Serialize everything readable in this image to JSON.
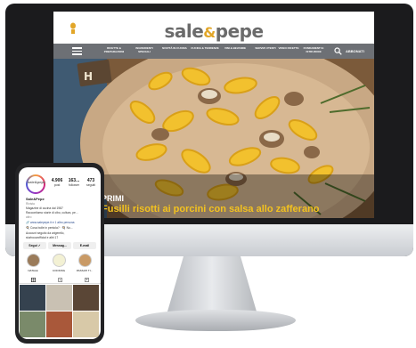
{
  "site": {
    "logo_left": "sale",
    "logo_amp": "&",
    "logo_right": "pepe",
    "nav": [
      "Ricette & preparazioni",
      "Ingredienti speciali",
      "Novità in cucina",
      "Cucina & tendenze",
      "Vini & bevande",
      "Servizi utenti",
      "Video ricette",
      "Fondamenti e istruzioni"
    ],
    "subscribe_label": "ABBONATI",
    "hero_kicker": "PRIMI",
    "hero_headline": "Fusilli risotti ai porcini con salsa allo zafferano"
  },
  "instagram": {
    "avatar_text": "sale&pepe",
    "stats": [
      {
        "num": "4.906",
        "label": "post"
      },
      {
        "num": "163...",
        "label": "follower"
      },
      {
        "num": "473",
        "label": "seguiti"
      }
    ],
    "name": "Sale&Pepe",
    "category": "Rivista",
    "bio": [
      "Magazine di cucina dal 1987",
      "Raccontiamo storie di cibo, cultura, pe...",
      "altro"
    ],
    "link": "🔗 www.salepepe.it e 1 altro persona",
    "cta": "🍳 Cosa bolle in pentola? · 🍳 Nu...",
    "followed_by": "Account seguito da arigerello,",
    "followed_by_2": "sturboowofficial e altri 17",
    "buttons": [
      "Segui ✓",
      "Messag...",
      "E-mail"
    ],
    "highlights": [
      "NATALE",
      "COOKING",
      "PASSATI TI..."
    ]
  }
}
